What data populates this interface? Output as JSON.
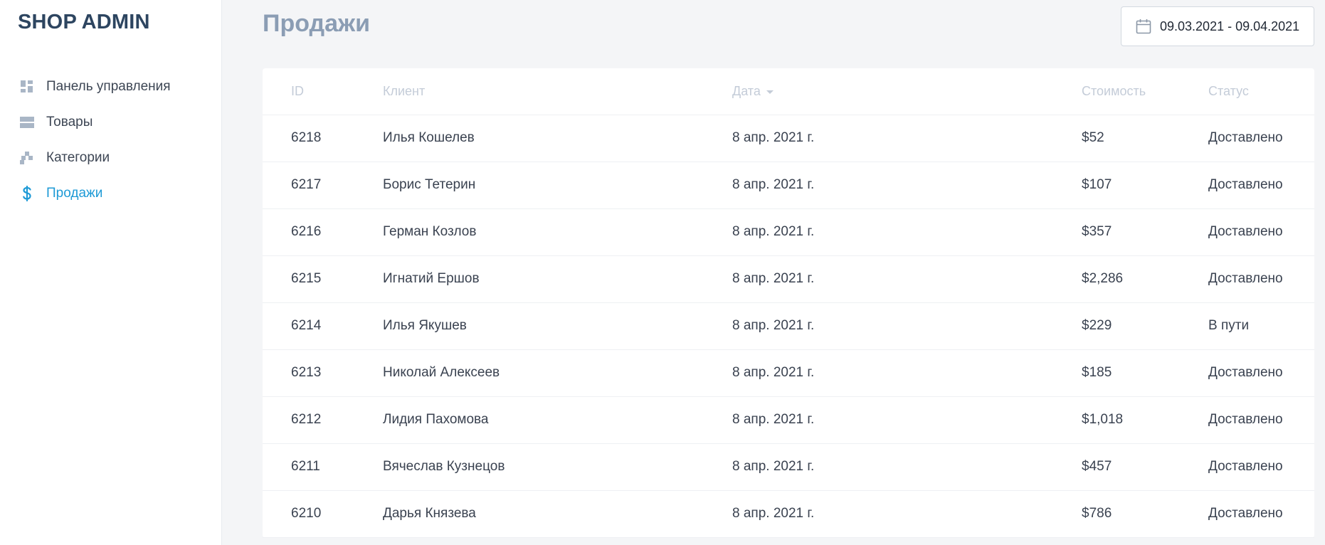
{
  "app": {
    "brand": "SHOP ADMIN"
  },
  "sidebar": {
    "items": [
      {
        "label": "Панель управления",
        "icon": "dashboard-icon",
        "active": false
      },
      {
        "label": "Товары",
        "icon": "products-icon",
        "active": false
      },
      {
        "label": "Категории",
        "icon": "categories-icon",
        "active": false
      },
      {
        "label": "Продажи",
        "icon": "dollar-icon",
        "active": true
      }
    ]
  },
  "header": {
    "title": "Продажи",
    "date_range": "09.03.2021 - 09.04.2021"
  },
  "table": {
    "columns": {
      "id": "ID",
      "client": "Клиент",
      "date": "Дата",
      "cost": "Стоимость",
      "status": "Статус"
    },
    "rows": [
      {
        "id": "6218",
        "client": "Илья Кошелев",
        "date": "8 апр. 2021 г.",
        "cost": "$52",
        "status": "Доставлено"
      },
      {
        "id": "6217",
        "client": "Борис Тетерин",
        "date": "8 апр. 2021 г.",
        "cost": "$107",
        "status": "Доставлено"
      },
      {
        "id": "6216",
        "client": "Герман Козлов",
        "date": "8 апр. 2021 г.",
        "cost": "$357",
        "status": "Доставлено"
      },
      {
        "id": "6215",
        "client": "Игнатий Ершов",
        "date": "8 апр. 2021 г.",
        "cost": "$2,286",
        "status": "Доставлено"
      },
      {
        "id": "6214",
        "client": "Илья Якушев",
        "date": "8 апр. 2021 г.",
        "cost": "$229",
        "status": "В пути"
      },
      {
        "id": "6213",
        "client": "Николай Алексеев",
        "date": "8 апр. 2021 г.",
        "cost": "$185",
        "status": "Доставлено"
      },
      {
        "id": "6212",
        "client": "Лидия Пахомова",
        "date": "8 апр. 2021 г.",
        "cost": "$1,018",
        "status": "Доставлено"
      },
      {
        "id": "6211",
        "client": "Вячеслав Кузнецов",
        "date": "8 апр. 2021 г.",
        "cost": "$457",
        "status": "Доставлено"
      },
      {
        "id": "6210",
        "client": "Дарья Князева",
        "date": "8 апр. 2021 г.",
        "cost": "$786",
        "status": "Доставлено"
      }
    ]
  },
  "colors": {
    "accent": "#1e9ad6",
    "title": "#8b9db4",
    "brand": "#2d4560"
  }
}
